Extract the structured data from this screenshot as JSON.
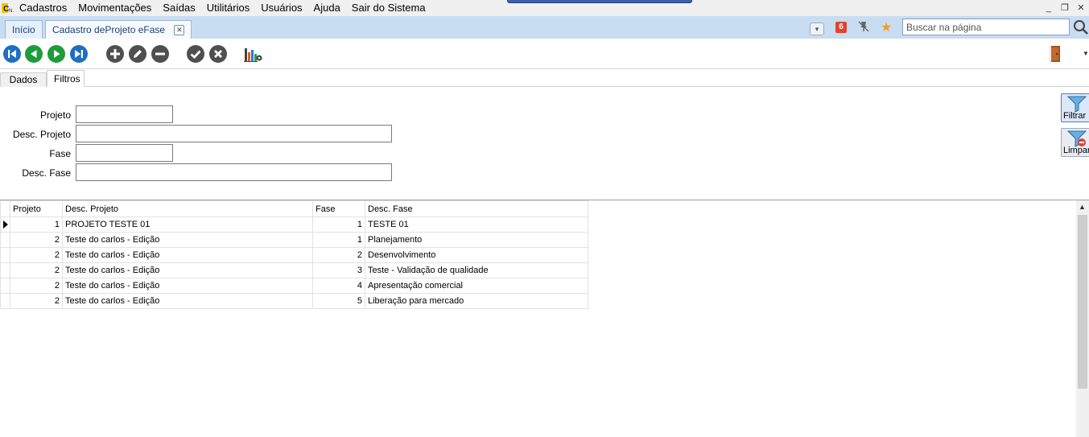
{
  "menu": {
    "items": [
      "Cadastros",
      "Movimentações",
      "Saídas",
      "Utilitários",
      "Usuários",
      "Ajuda",
      "Sair do Sistema"
    ]
  },
  "tabs": {
    "inicio": "Início",
    "cadastro": "Cadastro deProjeto eFase"
  },
  "header": {
    "notification_count": "6",
    "search_placeholder": "Buscar na página"
  },
  "toolbar": {
    "buttons": [
      "first-record",
      "previous-record",
      "next-record",
      "last-record",
      "add",
      "edit",
      "delete",
      "confirm",
      "cancel",
      "report-chart"
    ]
  },
  "subtabs": {
    "dados": "Dados",
    "filtros": "Filtros"
  },
  "filters": {
    "projeto_label": "Projeto",
    "desc_projeto_label": "Desc. Projeto",
    "fase_label": "Fase",
    "desc_fase_label": "Desc. Fase",
    "projeto_value": "",
    "desc_projeto_value": "",
    "fase_value": "",
    "desc_fase_value": "",
    "filtrar_label": "Filtrar",
    "limpar_label": "Limpar"
  },
  "grid": {
    "columns": [
      "Projeto",
      "Desc. Projeto",
      "Fase",
      "Desc. Fase"
    ],
    "rows": [
      {
        "projeto": "1",
        "desc_projeto": "PROJETO TESTE 01",
        "fase": "1",
        "desc_fase": "TESTE 01"
      },
      {
        "projeto": "2",
        "desc_projeto": "Teste do carlos - Edição",
        "fase": "1",
        "desc_fase": "Planejamento"
      },
      {
        "projeto": "2",
        "desc_projeto": "Teste do carlos - Edição",
        "fase": "2",
        "desc_fase": "Desenvolvimento"
      },
      {
        "projeto": "2",
        "desc_projeto": "Teste do carlos - Edição",
        "fase": "3",
        "desc_fase": "Teste - Validação de qualidade"
      },
      {
        "projeto": "2",
        "desc_projeto": "Teste do carlos - Edição",
        "fase": "4",
        "desc_fase": "Apresentação comercial"
      },
      {
        "projeto": "2",
        "desc_projeto": "Teste do carlos - Edição",
        "fase": "5",
        "desc_fase": "Liberação para mercado"
      }
    ]
  },
  "colors": {
    "nav_blue": "#1e6fc4",
    "action_gray": "#4f4f4f",
    "tab_bar": "#c8dcf2",
    "badge_red": "#e0452f",
    "star": "#f0a020"
  }
}
